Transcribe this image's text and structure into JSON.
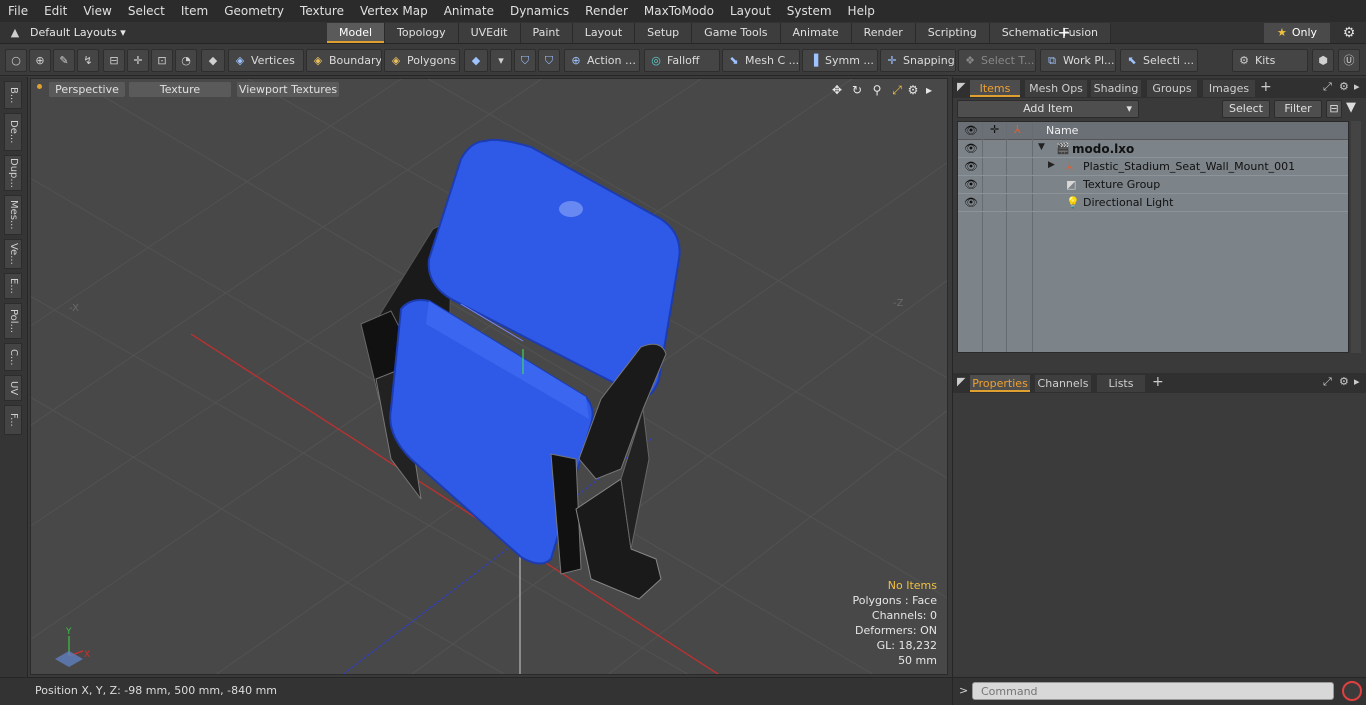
{
  "menu": [
    "File",
    "Edit",
    "View",
    "Select",
    "Item",
    "Geometry",
    "Texture",
    "Vertex Map",
    "Animate",
    "Dynamics",
    "Render",
    "MaxToModo",
    "Layout",
    "System",
    "Help"
  ],
  "layout": {
    "selector": "Default Layouts ▾",
    "tabs": [
      "Model",
      "Topology",
      "UVEdit",
      "Paint",
      "Layout",
      "Setup",
      "Game Tools",
      "Animate",
      "Render",
      "Scripting",
      "Schematic Fusion"
    ],
    "active_tab": "Model",
    "plus": "+",
    "only_label": "Only"
  },
  "toolbar": {
    "vertices": "Vertices",
    "boundary": "Boundary",
    "polygons": "Polygons",
    "action": "Action",
    "falloff": "Falloff",
    "mesh_c": "Mesh C ...",
    "symm": "Symm ...",
    "snapping": "Snapping",
    "select_t": "Select T...",
    "work_pl": "Work Pl...",
    "selecti": "Selecti ...",
    "kits": "Kits"
  },
  "left_tabs": [
    "B...",
    "De...",
    "Dup...",
    "Mes...",
    "Ve...",
    "E...",
    "Pol...",
    "C...",
    "UV",
    "F..."
  ],
  "viewport": {
    "perspective": "Perspective",
    "texture": "Texture",
    "viewport_textures": "Viewport Textures",
    "axis_neg_x": "-X",
    "axis_neg_z": "-Z",
    "info": {
      "no_items": "No Items",
      "polygons": "Polygons : Face",
      "channels": "Channels: 0",
      "deformers": "Deformers: ON",
      "gl": "GL: 18,232",
      "scale": "50 mm"
    },
    "gizmo": {
      "y": "Y",
      "x": "X"
    }
  },
  "status": {
    "position": "Position X, Y, Z:   -98 mm, 500 mm, -840 mm"
  },
  "items_panel": {
    "tabs": [
      "Items",
      "Mesh Ops",
      "Shading",
      "Groups",
      "Images"
    ],
    "active_tab": "Items",
    "add_item": "Add Item",
    "select": "Select",
    "filter": "Filter",
    "name_header": "Name",
    "rows": [
      {
        "label": "modo.lxo"
      },
      {
        "label": "Plastic_Stadium_Seat_Wall_Mount_001"
      },
      {
        "label": "Texture Group"
      },
      {
        "label": "Directional Light"
      }
    ]
  },
  "props_panel": {
    "tabs": [
      "Properties",
      "Channels",
      "Lists"
    ],
    "active_tab": "Properties"
  },
  "command": {
    "placeholder": "Command"
  },
  "colors": {
    "seat_blue": "#2f5ae8",
    "accent": "#e0a030",
    "axis_red": "#c03030",
    "axis_blue": "#3040c0"
  }
}
